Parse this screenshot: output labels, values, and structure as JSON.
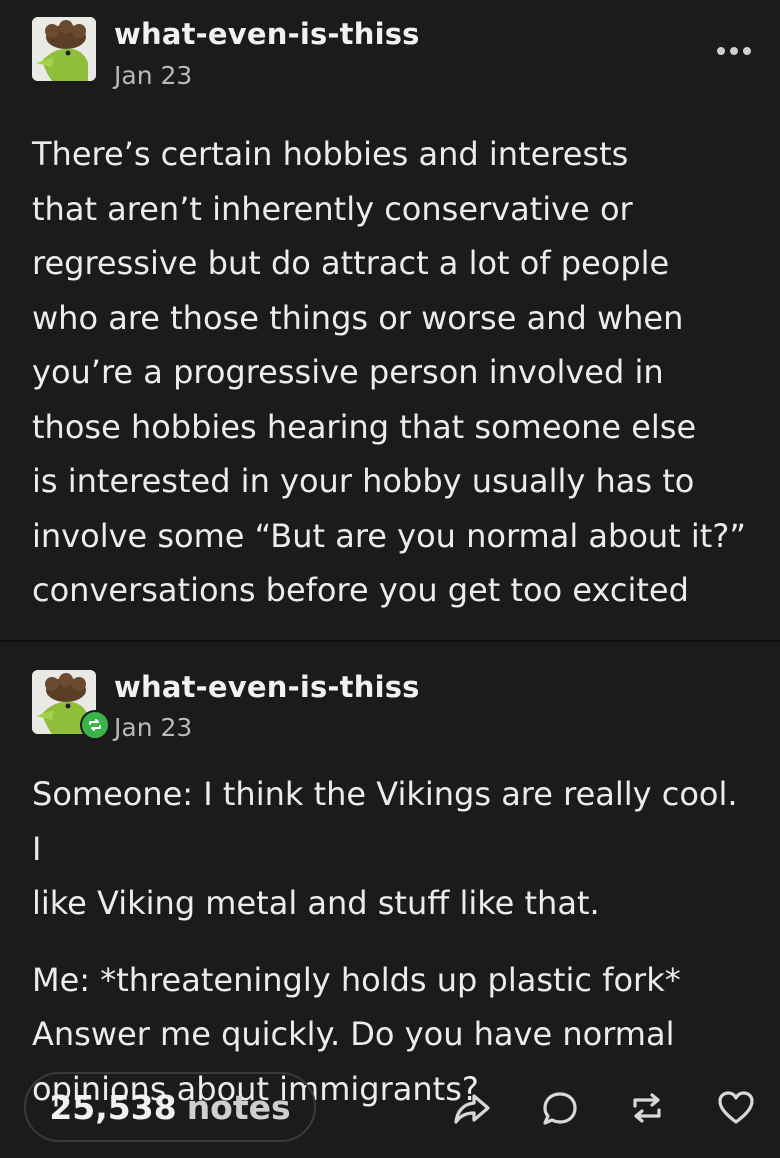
{
  "post": {
    "username": "what-even-is-thiss",
    "date": "Jan 23",
    "body": [
      "There’s certain hobbies and interests",
      "that aren’t inherently conservative or",
      "regressive but do attract a lot of people",
      "who are those things or worse and when",
      "you’re a progressive person involved in",
      "those hobbies hearing that someone else",
      "is interested in your hobby usually has to",
      "involve some “But are you normal about it?”",
      "conversations before you get too excited"
    ]
  },
  "reblog": {
    "username": "what-even-is-thiss",
    "date": "Jan 23",
    "paragraph1": [
      "Someone: I think the Vikings are really cool. I",
      "like Viking metal and stuff like that."
    ],
    "paragraph2": [
      "Me: *threateningly holds up plastic fork*",
      "Answer me quickly. Do you have normal",
      "opinions about immigrants?"
    ]
  },
  "footer": {
    "notes_count": "25,538",
    "notes_label": "notes"
  },
  "icons": {
    "more": "more-horizontal-icon",
    "share": "share-icon",
    "reply": "reply-icon",
    "reblog": "reblog-icon",
    "like": "heart-icon"
  },
  "colors": {
    "background": "#1b1b1b",
    "reblog_green": "#3bb34a"
  }
}
